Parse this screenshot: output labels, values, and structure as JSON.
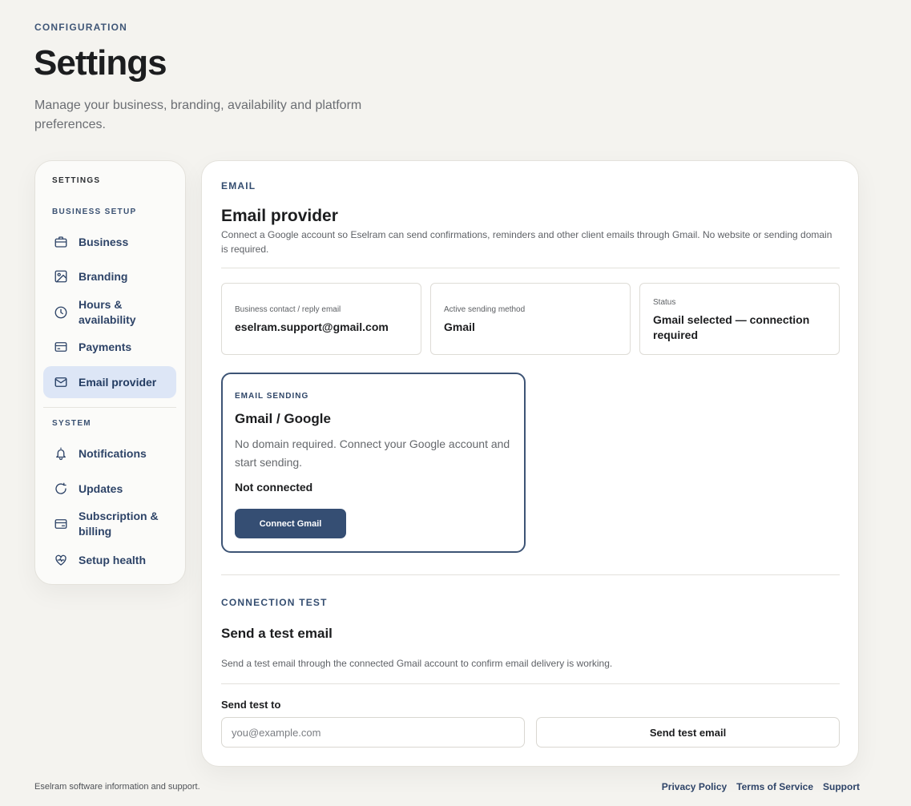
{
  "header": {
    "eyebrow": "CONFIGURATION",
    "title": "Settings",
    "subtitle": "Manage your business, branding, availability and platform preferences."
  },
  "sidebar": {
    "heading": "SETTINGS",
    "groups": [
      {
        "label": "BUSINESS SETUP",
        "items": [
          {
            "label": "Business",
            "icon": "briefcase-icon"
          },
          {
            "label": "Branding",
            "icon": "image-icon"
          },
          {
            "label": "Hours & availability",
            "icon": "clock-icon"
          },
          {
            "label": "Payments",
            "icon": "credit-card-icon"
          },
          {
            "label": "Email provider",
            "icon": "mail-icon",
            "active": true
          }
        ]
      },
      {
        "label": "SYSTEM",
        "items": [
          {
            "label": "Notifications",
            "icon": "bell-icon"
          },
          {
            "label": "Updates",
            "icon": "refresh-icon"
          },
          {
            "label": "Subscription & billing",
            "icon": "billing-card-icon"
          },
          {
            "label": "Setup health",
            "icon": "heart-pulse-icon"
          }
        ]
      }
    ]
  },
  "email": {
    "eyebrow": "EMAIL",
    "title": "Email provider",
    "description": "Connect a Google account so Eselram can send confirmations, reminders and other client emails through Gmail. No website or sending domain is required.",
    "info_cards": [
      {
        "label": "Business contact / reply email",
        "value": "eselram.support@gmail.com"
      },
      {
        "label": "Active sending method",
        "value": "Gmail"
      },
      {
        "label": "Status",
        "value": "Gmail selected — connection required"
      }
    ],
    "sending_card": {
      "eyebrow": "EMAIL SENDING",
      "title": "Gmail / Google",
      "description": "No domain required. Connect your Google account and start sending.",
      "status": "Not connected",
      "button": "Connect Gmail"
    }
  },
  "connection_test": {
    "eyebrow": "CONNECTION TEST",
    "title": "Send a test email",
    "description": "Send a test email through the connected Gmail account to confirm email delivery is working.",
    "field_label": "Send test to",
    "placeholder": "you@example.com",
    "value": "",
    "button": "Send test email"
  },
  "footer": {
    "left": "Eselram software information and support.",
    "links": [
      "Privacy Policy",
      "Terms of Service",
      "Support"
    ]
  },
  "colors": {
    "accent": "#354e73",
    "active_nav_bg": "#dde6f6",
    "page_bg": "#f4f3ef"
  }
}
